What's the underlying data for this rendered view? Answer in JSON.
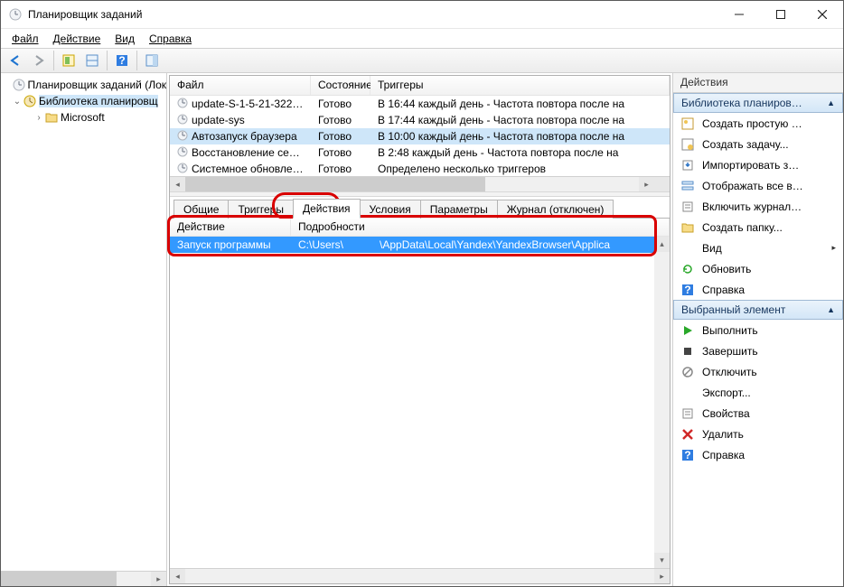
{
  "window": {
    "title": "Планировщик заданий"
  },
  "menu": {
    "file": "Файл",
    "action": "Действие",
    "view": "Вид",
    "help": "Справка"
  },
  "tree": {
    "root": "Планировщик заданий (Лок",
    "library": "Библиотека планировщ",
    "microsoft": "Microsoft"
  },
  "tasklist": {
    "headers": {
      "file": "Файл",
      "state": "Состояние",
      "triggers": "Триггеры"
    },
    "rows": [
      {
        "name": "update-S-1-5-21-322…",
        "state": "Готово",
        "trigger": "В 16:44 каждый день - Частота повтора после на"
      },
      {
        "name": "update-sys",
        "state": "Готово",
        "trigger": "В 17:44 каждый день - Частота повтора после на"
      },
      {
        "name": "Автозапуск браузера",
        "state": "Готово",
        "trigger": "В 10:00 каждый день - Частота повтора после на"
      },
      {
        "name": "Восстановление се…",
        "state": "Готово",
        "trigger": "В 2:48 каждый день - Частота повтора после на"
      },
      {
        "name": "Системное обновле…",
        "state": "Готово",
        "trigger": "Определено несколько триггеров"
      }
    ]
  },
  "tabs": {
    "general": "Общие",
    "triggers": "Триггеры",
    "actions": "Действия",
    "conditions": "Условия",
    "params": "Параметры",
    "history": "Журнал (отключен)"
  },
  "details": {
    "headers": {
      "action": "Действие",
      "details": "Подробности"
    },
    "row": {
      "action": "Запуск программы",
      "details": "C:\\Users\\            \\AppData\\Local\\Yandex\\YandexBrowser\\Applica"
    }
  },
  "actions_pane": {
    "title": "Действия",
    "section1": "Библиотека планиров…",
    "items1": {
      "create_basic": "Создать простую …",
      "create_task": "Создать задачу...",
      "import": "Импортировать з…",
      "show_all": "Отображать все в…",
      "enable_log": "Включить журнал…",
      "new_folder": "Создать папку...",
      "view": "Вид",
      "refresh": "Обновить",
      "help1": "Справка"
    },
    "section2": "Выбранный элемент",
    "items2": {
      "run": "Выполнить",
      "end": "Завершить",
      "disable": "Отключить",
      "export": "Экспорт...",
      "properties": "Свойства",
      "delete": "Удалить",
      "help2": "Справка"
    }
  }
}
